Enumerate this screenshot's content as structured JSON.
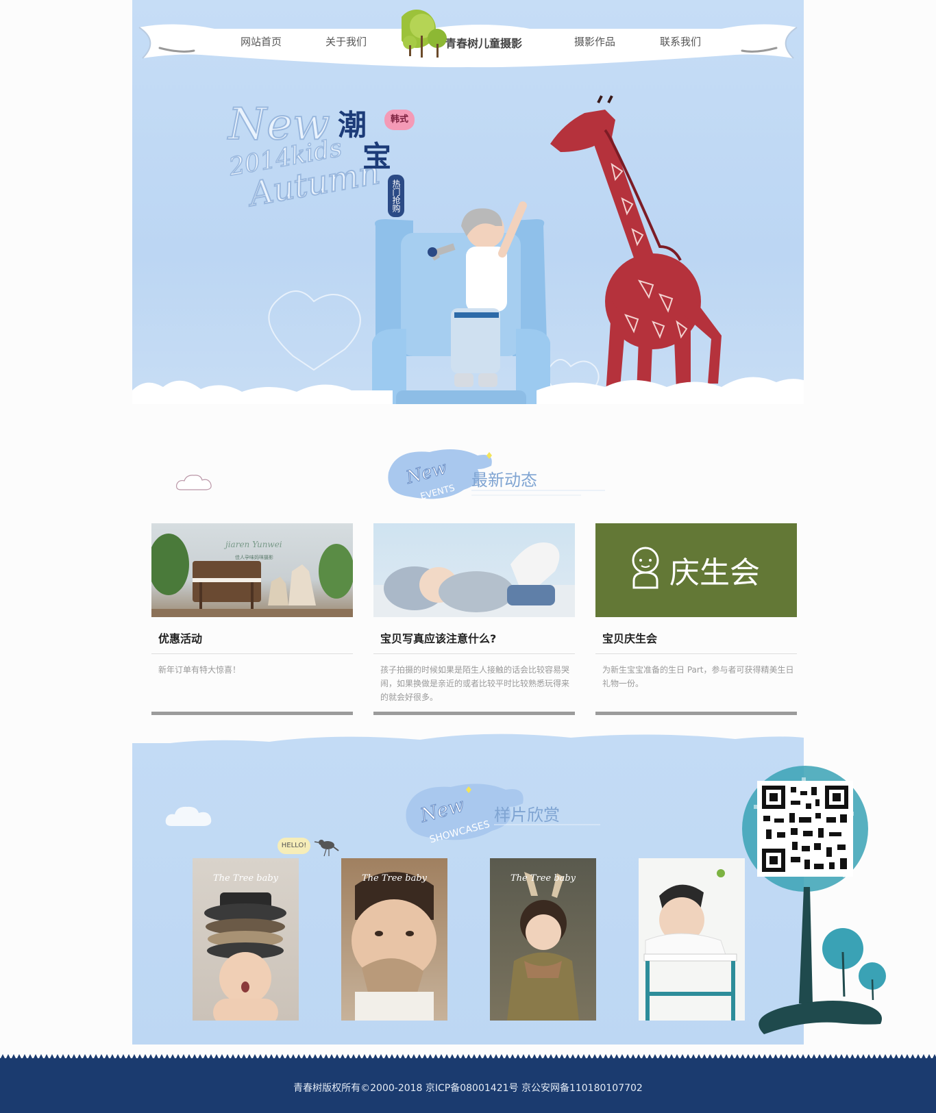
{
  "nav": {
    "items": [
      "网站首页",
      "关于我们",
      "摄影作品",
      "联系我们"
    ],
    "brand": "青春树儿童摄影"
  },
  "hero": {
    "en_line1": "New",
    "en_line2": "2014kids",
    "en_line3": "Autumn",
    "cn_title_1": "潮",
    "cn_title_2": "宝",
    "tag": "韩式",
    "vtag": "热门抢购"
  },
  "news": {
    "badge_en_1": "New",
    "badge_en_2": "EVENTS",
    "title": "最新动态",
    "cards": [
      {
        "title": "优惠活动",
        "desc": "新年订单有特大惊喜！",
        "image_text_1": "jiaren Yunwei",
        "image_text_2": "佳人孕味妈咪摄影"
      },
      {
        "title": "宝贝写真应该注意什么?",
        "desc": "孩子拍摄的时候如果是陌生人接触的话会比较容易哭闹，如果换做是亲近的或者比较平时比较熟悉玩得来的就会好很多。"
      },
      {
        "title": "宝贝庆生会",
        "desc": "为新生宝宝准备的生日 Part，参与者可获得精美生日礼物一份。",
        "image_text": "庆生会"
      }
    ]
  },
  "showcase": {
    "badge_en_1": "New",
    "badge_en_2": "SHOWCASES",
    "title": "样片欣赏",
    "hello": "HELLO!",
    "photos": [
      {
        "caption": "The Tree baby"
      },
      {
        "caption": "The Tree baby"
      },
      {
        "caption": "The Tree baby"
      },
      {
        "caption": ""
      }
    ]
  },
  "footer": {
    "text": "青春树版权所有©2000-2018   京ICP备08001421号   京公安网备110180107702"
  },
  "colors": {
    "sky": "#bcd6f3",
    "footer": "#1b3b6f",
    "card_bar": "#9b9b9b",
    "green_card": "#637836"
  }
}
